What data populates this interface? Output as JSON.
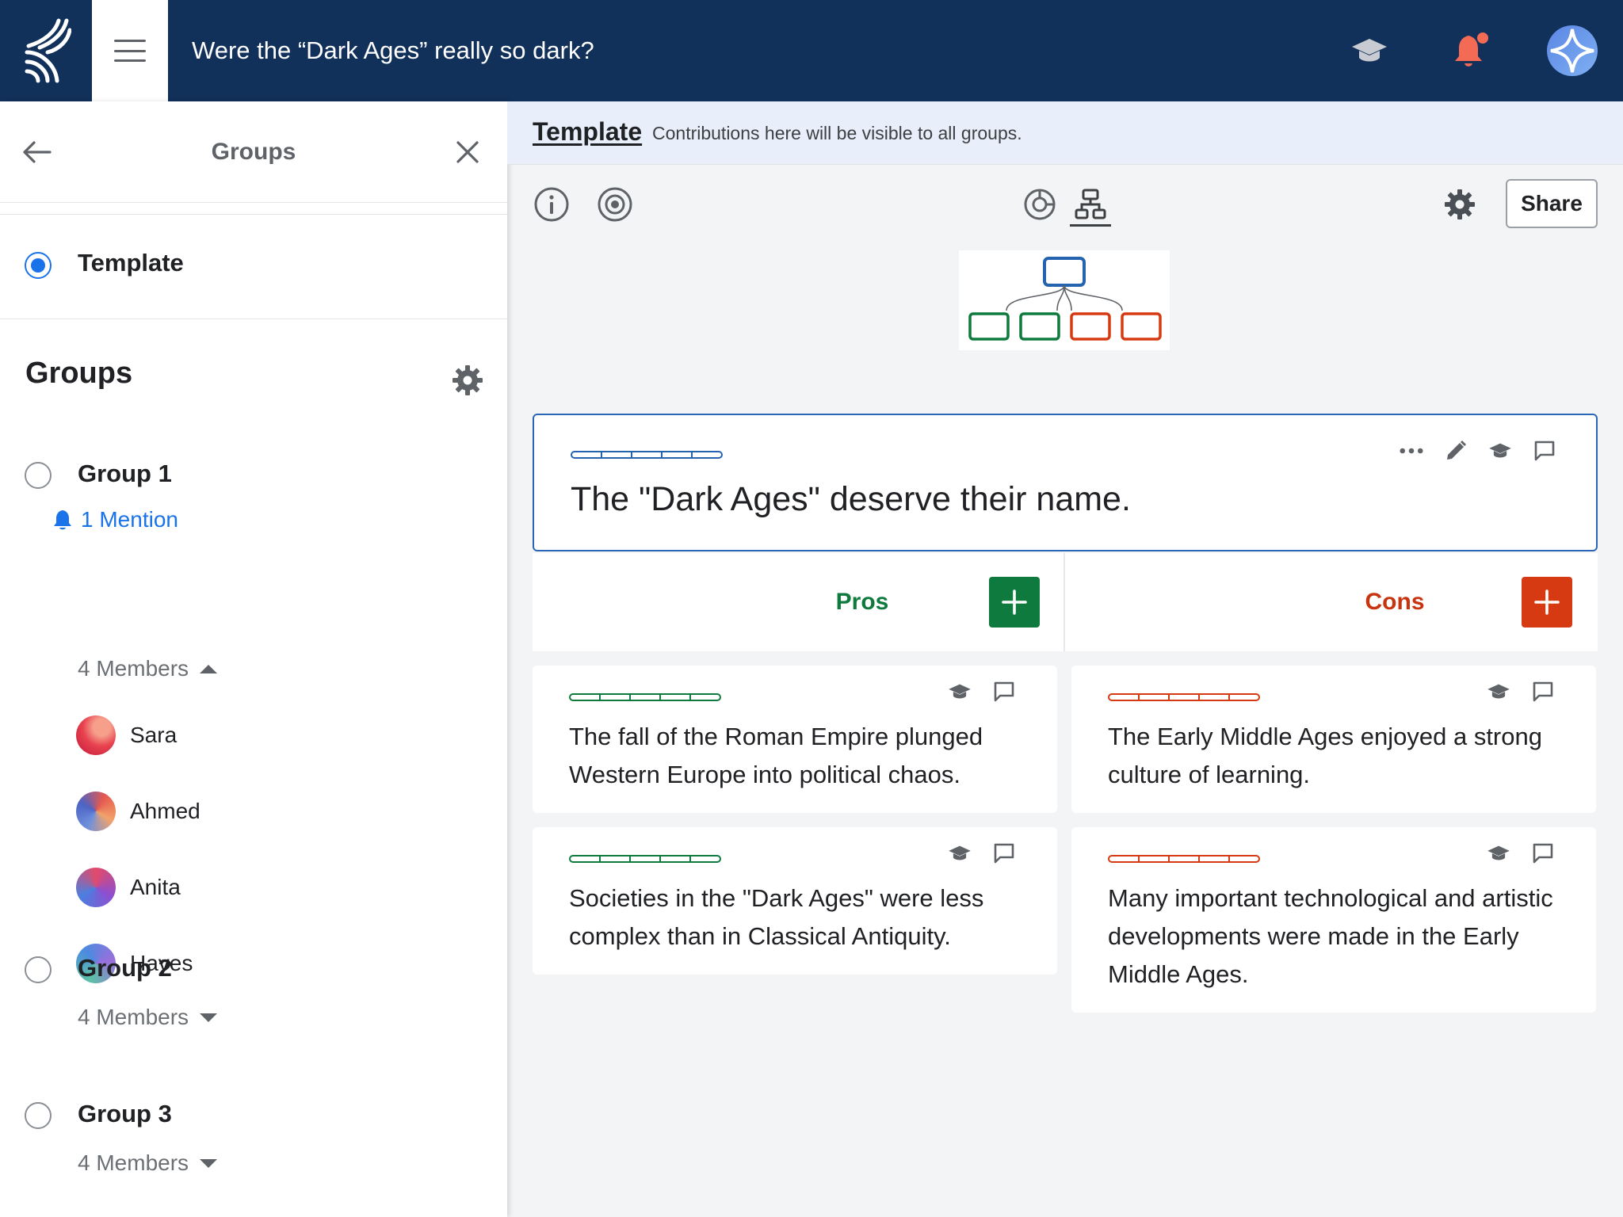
{
  "header": {
    "title": "Were the “Dark Ages” really so dark?",
    "brand_color": "#11305a"
  },
  "sidebar": {
    "title": "Groups",
    "template_label": "Template",
    "groups_heading": "Groups",
    "groups": [
      {
        "name": "Group 1",
        "mention": "1 Mention",
        "members_label": "4 Members",
        "expanded": true,
        "members": [
          "Sara",
          "Ahmed",
          "Anita",
          "Hayes"
        ]
      },
      {
        "name": "Group 2",
        "members_label": "4 Members",
        "expanded": false
      },
      {
        "name": "Group 3",
        "members_label": "4 Members",
        "expanded": false
      }
    ]
  },
  "banner": {
    "link": "Template",
    "note": "Contributions here will be visible to all groups."
  },
  "toolbar": {
    "share_label": "Share",
    "icons": [
      "info-icon",
      "eye-icon",
      "sunburst-chart-icon",
      "tree-view-icon",
      "gear-icon"
    ]
  },
  "thesis": {
    "text": "The \"Dark Ages\" deserve their name."
  },
  "columns": {
    "pros_label": "Pros",
    "cons_label": "Cons",
    "pros_color": "#0f7a3e",
    "cons_color": "#d63a12"
  },
  "pros": [
    {
      "text": "The fall of the Roman Empire plunged Western Europe into political chaos."
    },
    {
      "text": "Societies in the \"Dark Ages\" were less complex than in Classical Antiquity."
    }
  ],
  "cons": [
    {
      "text": "The Early Middle Ages enjoyed a strong culture of learning."
    },
    {
      "text": "Many important technological and artistic developments were made in the Early Middle Ages."
    }
  ]
}
